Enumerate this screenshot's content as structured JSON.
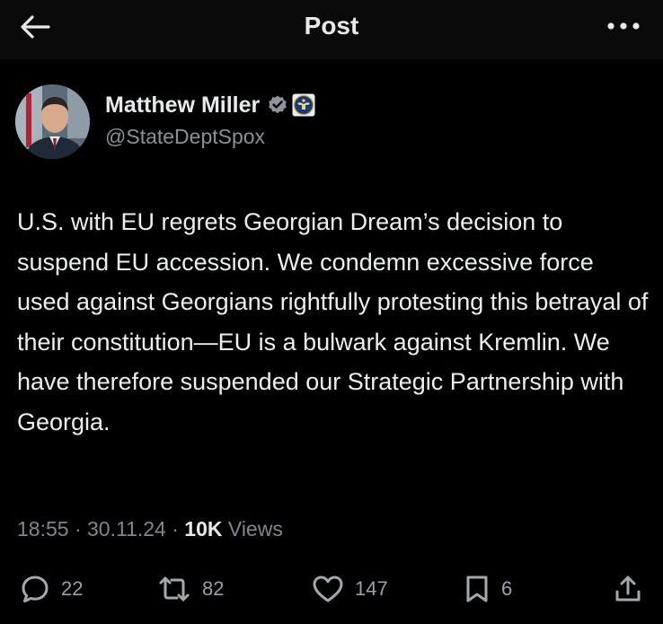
{
  "header": {
    "title": "Post"
  },
  "author": {
    "name": "Matthew Miller",
    "handle": "@StateDeptSpox",
    "verified": true
  },
  "post": {
    "text": "U.S. with EU regrets Georgian Dream’s decision to suspend EU accession. We condemn excessive force used against Georgians rightfully protesting this betrayal of their constitution—EU is a bulwark against Kremlin. We have therefore suspended our Strategic Partnership with Georgia."
  },
  "meta": {
    "time": "18:55",
    "sep1": " · ",
    "date": "30.11.24",
    "sep2": " · ",
    "views_count": "10K",
    "views_label": " Views"
  },
  "actions": {
    "replies": "22",
    "reposts": "82",
    "likes": "147",
    "bookmarks": "6"
  },
  "icons": {
    "back": "arrow-left-icon",
    "more": "more-dots-icon",
    "verified": "verified-badge-icon",
    "seal": "state-department-seal-icon",
    "reply": "reply-icon",
    "repost": "repost-icon",
    "like": "heart-icon",
    "bookmark": "bookmark-icon",
    "share": "share-icon"
  },
  "colors": {
    "background": "#000000",
    "verified_blue": "#1d9bf0",
    "text_primary": "#e7e9ea",
    "text_secondary": "#8b9096"
  }
}
